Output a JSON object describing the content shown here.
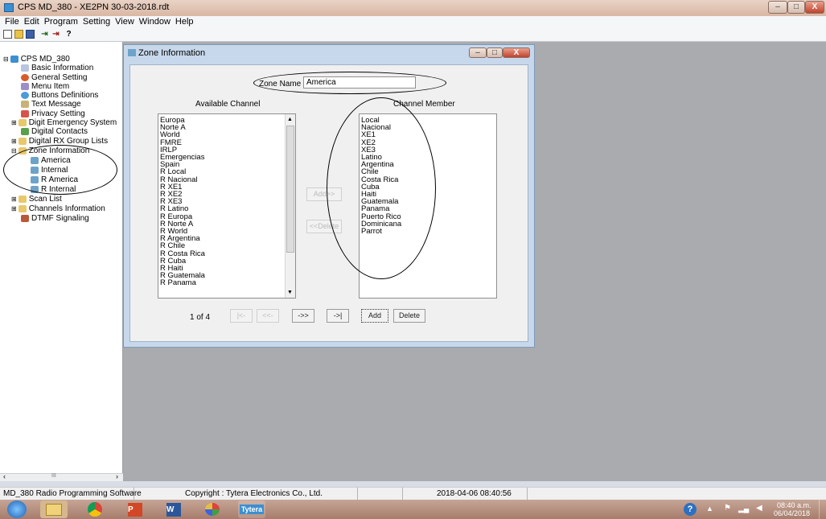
{
  "window": {
    "title": "CPS MD_380 - XE2PN 30-03-2018.rdt",
    "minimize_glyph": "–",
    "maximize_glyph": "□",
    "close_glyph": "X"
  },
  "menu": [
    "File",
    "Edit",
    "Program",
    "Setting",
    "View",
    "Window",
    "Help"
  ],
  "toolbar_icons": [
    "new-icon",
    "open-icon",
    "save-icon",
    "read-icon",
    "write-icon",
    "help-icon"
  ],
  "tree": {
    "root": "CPS MD_380",
    "items": [
      "Basic Information",
      "General Setting",
      "Menu Item",
      "Buttons Definitions",
      "Text Message",
      "Privacy Setting",
      "Digit Emergency System",
      "Digital Contacts",
      "Digital RX Group Lists",
      "Zone Information",
      "America",
      "Internal",
      "R America",
      "R Internal",
      "Scan List",
      "Channels Information",
      "DTMF Signaling"
    ],
    "scroll_mark": "III"
  },
  "zone_window": {
    "title": "Zone Information",
    "zone_name_label": "Zone Name",
    "zone_name_value": "America",
    "available_label": "Available Channel",
    "member_label": "Channel Member",
    "available_channels": [
      "Europa",
      "Norte A",
      "World",
      "FMRE",
      "IRLP",
      "Emergencias",
      "Spain",
      "R Local",
      "R Nacional",
      "R XE1",
      "R XE2",
      "R XE3",
      "R Latino",
      "R Europa",
      "R Norte A",
      "R World",
      "R Argentina",
      "R Chile",
      "R Costa Rica",
      "R Cuba",
      "R Haiti",
      "R Guatemala",
      "R Panama"
    ],
    "channel_members": [
      "Local",
      "Nacional",
      "XE1",
      "XE2",
      "XE3",
      "Latino",
      "Argentina",
      "Chile",
      "Costa Rica",
      "Cuba",
      "Haiti",
      "Guatemala",
      "Panama",
      "Puerto Rico",
      "Dominicana",
      "Parrot"
    ],
    "add_arrow_label": "Add>>",
    "delete_arrow_label": "<<Delete",
    "page_indicator": "1 of 4",
    "nav_first": "|<-",
    "nav_prev": "<<-",
    "nav_next": "->>",
    "nav_last": "->|",
    "add_label": "Add",
    "delete_label": "Delete"
  },
  "status": {
    "app": "MD_380 Radio Programming Software",
    "copyright": "Copyright : Tytera Electronics Co., Ltd.",
    "datetime": "2018-04-06 08:40:56"
  },
  "taskbar": {
    "apps": [
      "start-orb",
      "explorer",
      "chrome",
      "powerpoint",
      "word",
      "paint",
      "tytera"
    ],
    "tytera_label": "Tytera",
    "ppt_label": "P",
    "word_label": "W",
    "time": "08:40 a.m.",
    "date": "06/04/2018"
  }
}
